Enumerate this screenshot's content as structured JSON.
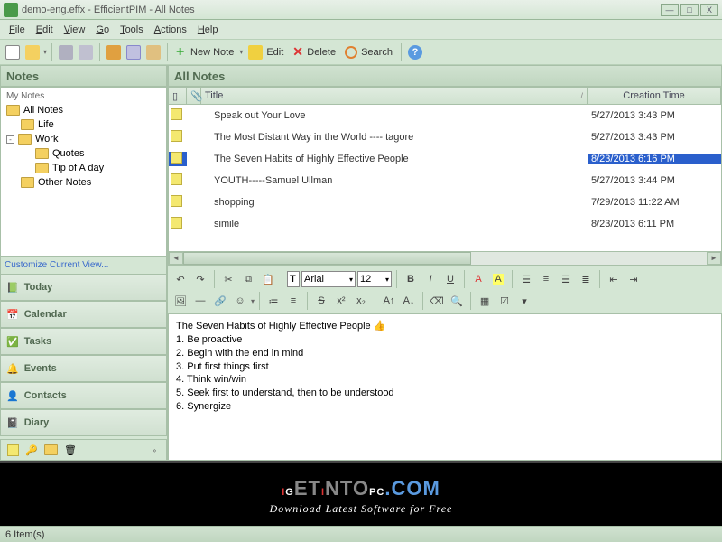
{
  "window": {
    "title": "demo-eng.effx - EfficientPIM - All Notes"
  },
  "menus": {
    "file": "File",
    "edit": "Edit",
    "view": "View",
    "go": "Go",
    "tools": "Tools",
    "actions": "Actions",
    "help": "Help"
  },
  "toolbar": {
    "newnote": "New Note",
    "newnote_arrow": "▾",
    "edit": "Edit",
    "delete": "Delete",
    "search": "Search"
  },
  "sidebar": {
    "header": "Notes",
    "mynotes": "My Notes",
    "root": "All Notes",
    "tree": {
      "life": "Life",
      "work": "Work",
      "quotes": "Quotes",
      "tip": "Tip of A day",
      "other": "Other Notes"
    },
    "customize": "Customize Current View...",
    "nav": {
      "today": "Today",
      "calendar": "Calendar",
      "tasks": "Tasks",
      "events": "Events",
      "contacts": "Contacts",
      "diary": "Diary"
    }
  },
  "list": {
    "header": "All Notes",
    "columns": {
      "title": "Title",
      "date": "Creation Time"
    },
    "rows": [
      {
        "title": "Speak out Your Love",
        "date": "5/27/2013 3:43 PM",
        "selected": false
      },
      {
        "title": "The Most Distant Way in the World  ---- tagore",
        "date": "5/27/2013 3:43 PM",
        "selected": false
      },
      {
        "title": "The Seven Habits of Highly Effective People",
        "date": "8/23/2013 6:16 PM",
        "selected": true
      },
      {
        "title": "YOUTH-----Samuel Ullman",
        "date": "5/27/2013 3:44 PM",
        "selected": false
      },
      {
        "title": "shopping",
        "date": "7/29/2013 11:22 AM",
        "selected": false
      },
      {
        "title": "simile",
        "date": "8/23/2013 6:11 PM",
        "selected": false
      }
    ]
  },
  "editor": {
    "font": "Arial",
    "size": "12",
    "content_title": "The Seven Habits of Highly Effective People",
    "lines": [
      "1. Be proactive",
      "2. Begin with the end in mind",
      "3. Put first things first",
      "4. Think win/win",
      "5. Seek first to understand, then to be understood",
      "6. Synergize"
    ]
  },
  "banner": {
    "big_left": "IG",
    "big_mid1": "ET",
    "big_mid2": "I",
    "big_mid3": "NTO",
    "big_right": "PC",
    "big_suffix": ".COM",
    "sub": "Download Latest Software for Free"
  },
  "status": {
    "items": "6 Item(s)"
  }
}
